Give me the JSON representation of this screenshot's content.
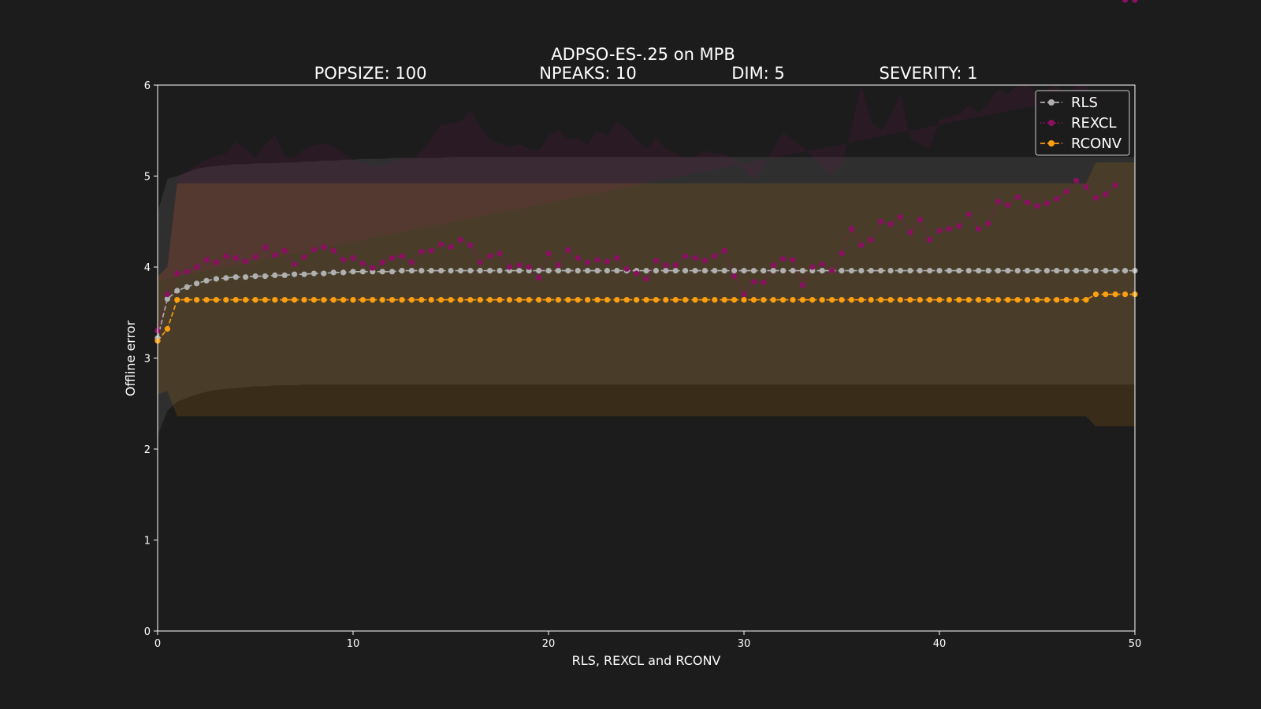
{
  "chart_data": {
    "type": "line",
    "title": "ADPSO-ES-.25 on MPB",
    "subtitles": [
      "POPSIZE: 100",
      "NPEAKS: 10",
      "DIM: 5",
      "SEVERITY: 1"
    ],
    "xlabel": "RLS, REXCL and RCONV",
    "ylabel": "Offline error",
    "xlim": [
      0,
      50
    ],
    "ylim": [
      0,
      6
    ],
    "xticks": [
      0,
      10,
      20,
      30,
      40,
      50
    ],
    "yticks": [
      0,
      1,
      2,
      3,
      4,
      5,
      6
    ],
    "grid": false,
    "legend_position": "top-right",
    "x": [
      0.0,
      0.5,
      1.0,
      1.5,
      2.0,
      2.5,
      3.0,
      3.5,
      4.0,
      4.5,
      5.0,
      5.5,
      6.0,
      6.5,
      7.0,
      7.5,
      8.0,
      8.5,
      9.0,
      9.5,
      10.0,
      10.5,
      11.0,
      11.5,
      12.0,
      12.5,
      13.0,
      13.5,
      14.0,
      14.5,
      15.0,
      15.5,
      16.0,
      16.5,
      17.0,
      17.5,
      18.0,
      18.5,
      19.0,
      19.5,
      20.0,
      20.5,
      21.0,
      21.5,
      22.0,
      22.5,
      23.0,
      23.5,
      24.0,
      24.5,
      25.0,
      25.5,
      26.0,
      26.5,
      27.0,
      27.5,
      28.0,
      28.5,
      29.0,
      29.5,
      30.0,
      30.5,
      31.0,
      31.5,
      32.0,
      32.5,
      33.0,
      33.5,
      34.0,
      34.5,
      35.0,
      35.5,
      36.0,
      36.5,
      37.0,
      37.5,
      38.0,
      38.5,
      39.0,
      39.5,
      40.0,
      40.5,
      41.0,
      41.5,
      42.0,
      42.5,
      43.0,
      43.5,
      44.0,
      44.5,
      45.0,
      45.5,
      46.0,
      46.5,
      47.0,
      47.5,
      48.0,
      48.5,
      49.0,
      49.5,
      50.0
    ],
    "series": [
      {
        "name": "RLS",
        "color": "#b0b0b0",
        "line": "dash",
        "values": [
          3.22,
          3.65,
          3.74,
          3.78,
          3.82,
          3.85,
          3.87,
          3.88,
          3.89,
          3.89,
          3.9,
          3.9,
          3.91,
          3.91,
          3.92,
          3.92,
          3.93,
          3.93,
          3.94,
          3.94,
          3.95,
          3.95,
          3.95,
          3.95,
          3.95,
          3.96,
          3.96,
          3.96,
          3.96,
          3.96,
          3.96,
          3.96,
          3.96,
          3.96,
          3.96,
          3.96,
          3.96,
          3.96,
          3.96,
          3.96,
          3.96,
          3.96,
          3.96,
          3.96,
          3.96,
          3.96,
          3.96,
          3.96,
          3.96,
          3.96,
          3.96,
          3.96,
          3.96,
          3.96,
          3.96,
          3.96,
          3.96,
          3.96,
          3.96,
          3.96,
          3.96,
          3.96,
          3.96,
          3.96,
          3.96,
          3.96,
          3.96,
          3.96,
          3.96,
          3.96,
          3.96,
          3.96,
          3.96,
          3.96,
          3.96,
          3.96,
          3.96,
          3.96,
          3.96,
          3.96,
          3.96,
          3.96,
          3.96,
          3.96,
          3.96,
          3.96,
          3.96,
          3.96,
          3.96,
          3.96,
          3.96,
          3.96,
          3.96,
          3.96,
          3.96,
          3.96,
          3.96,
          3.96,
          3.96,
          3.96,
          3.96
        ],
        "band_upper": [
          4.6,
          4.97,
          5.0,
          5.04,
          5.08,
          5.1,
          5.11,
          5.12,
          5.13,
          5.13,
          5.14,
          5.14,
          5.14,
          5.15,
          5.15,
          5.16,
          5.16,
          5.17,
          5.17,
          5.18,
          5.18,
          5.19,
          5.19,
          5.19,
          5.2,
          5.2,
          5.2,
          5.2,
          5.2,
          5.2,
          5.21,
          5.21,
          5.21,
          5.21,
          5.21,
          5.21,
          5.21,
          5.21,
          5.21,
          5.21,
          5.21,
          5.21,
          5.21,
          5.21,
          5.21,
          5.21,
          5.21,
          5.21,
          5.21,
          5.21,
          5.21,
          5.21,
          5.21,
          5.21,
          5.21,
          5.21,
          5.21,
          5.21,
          5.21,
          5.21,
          5.21,
          5.21,
          5.21,
          5.21,
          5.21,
          5.21,
          5.21,
          5.21,
          5.21,
          5.21,
          5.21,
          5.21,
          5.21,
          5.21,
          5.21,
          5.21,
          5.21,
          5.21,
          5.21,
          5.21,
          5.21,
          5.21,
          5.21,
          5.21,
          5.21,
          5.21,
          5.21,
          5.21,
          5.21,
          5.21,
          5.21,
          5.21,
          5.21,
          5.21,
          5.21,
          5.21,
          5.21,
          5.21,
          5.21,
          5.21,
          5.21
        ],
        "band_lower": [
          2.15,
          2.42,
          2.52,
          2.56,
          2.6,
          2.63,
          2.65,
          2.66,
          2.67,
          2.68,
          2.69,
          2.69,
          2.7,
          2.7,
          2.7,
          2.71,
          2.71,
          2.71,
          2.71,
          2.71,
          2.71,
          2.71,
          2.71,
          2.71,
          2.71,
          2.71,
          2.71,
          2.71,
          2.71,
          2.71,
          2.71,
          2.71,
          2.71,
          2.71,
          2.71,
          2.71,
          2.71,
          2.71,
          2.71,
          2.71,
          2.71,
          2.71,
          2.71,
          2.71,
          2.71,
          2.71,
          2.71,
          2.71,
          2.71,
          2.71,
          2.71,
          2.71,
          2.71,
          2.71,
          2.71,
          2.71,
          2.71,
          2.71,
          2.71,
          2.71,
          2.71,
          2.71,
          2.71,
          2.71,
          2.71,
          2.71,
          2.71,
          2.71,
          2.71,
          2.71,
          2.71,
          2.71,
          2.71,
          2.71,
          2.71,
          2.71,
          2.71,
          2.71,
          2.71,
          2.71,
          2.71,
          2.71,
          2.71,
          2.71,
          2.71,
          2.71,
          2.71,
          2.71,
          2.71,
          2.71,
          2.71,
          2.71,
          2.71,
          2.71,
          2.71,
          2.71,
          2.71,
          2.71,
          2.71,
          2.71,
          2.71
        ]
      },
      {
        "name": "REXCL",
        "color": "#8a1060",
        "line": "dotted",
        "values": [
          3.3,
          3.7,
          3.93,
          3.95,
          4.0,
          4.08,
          4.05,
          4.12,
          4.1,
          4.06,
          4.11,
          4.22,
          4.13,
          4.18,
          4.03,
          4.11,
          4.19,
          4.22,
          4.18,
          4.08,
          4.1,
          4.04,
          3.99,
          4.05,
          4.1,
          4.12,
          4.05,
          4.17,
          4.18,
          4.25,
          4.22,
          4.3,
          4.24,
          4.05,
          4.12,
          4.15,
          4.0,
          4.02,
          4.0,
          3.88,
          4.15,
          4.02,
          4.19,
          4.1,
          4.05,
          4.08,
          4.06,
          4.1,
          3.98,
          3.93,
          3.87,
          4.07,
          4.02,
          4.02,
          4.12,
          4.1,
          4.07,
          4.12,
          4.18,
          3.9,
          3.7,
          3.84,
          3.83,
          4.02,
          4.09,
          4.08,
          3.8,
          4.0,
          4.03,
          3.96,
          4.15,
          4.42,
          4.24,
          4.3,
          4.5,
          4.47,
          4.55,
          4.38,
          4.52,
          4.3,
          4.4,
          4.42,
          4.45,
          4.58,
          4.42,
          4.48,
          4.72,
          4.68,
          4.77,
          4.71,
          4.67,
          4.7,
          4.75,
          4.83,
          4.95,
          4.88,
          4.76,
          4.8,
          4.9
        ],
        "band_upper": [
          3.85,
          4.02,
          4.98,
          5.05,
          5.12,
          5.18,
          5.22,
          5.25,
          5.38,
          5.3,
          5.2,
          5.35,
          5.45,
          5.22,
          5.2,
          5.3,
          5.34,
          5.36,
          5.32,
          5.25,
          5.18,
          5.15,
          5.1,
          5.12,
          5.16,
          5.2,
          5.18,
          5.28,
          5.4,
          5.56,
          5.58,
          5.6,
          5.72,
          5.55,
          5.4,
          5.36,
          5.32,
          5.35,
          5.3,
          5.28,
          5.45,
          5.5,
          5.4,
          5.42,
          5.35,
          5.5,
          5.44,
          5.6,
          5.52,
          5.4,
          5.3,
          5.42,
          5.3,
          5.25,
          5.2,
          5.22,
          5.28,
          5.25,
          5.24,
          5.18,
          5.08,
          4.95,
          5.1,
          5.3,
          5.48,
          5.4,
          5.32,
          5.22,
          5.1,
          5.02,
          5.12,
          5.52,
          6.0,
          5.6,
          5.5,
          5.65,
          5.9,
          5.42,
          5.35,
          5.3,
          5.62,
          5.65,
          5.68,
          5.78,
          5.7,
          5.8,
          5.95,
          5.9,
          6.0,
          6.0,
          5.9,
          5.95,
          6.0,
          5.85,
          6.0,
          6.0,
          5.75,
          5.8,
          5.95
        ],
        "band_lower": [
          2.72,
          3.3,
          2.86,
          2.84,
          2.8,
          2.85,
          2.92,
          2.98,
          2.85,
          2.8,
          2.88,
          2.96,
          2.9,
          2.92,
          2.86,
          2.88,
          2.95,
          3.02,
          2.98,
          2.9,
          2.86,
          2.84,
          2.8,
          2.86,
          2.92,
          2.95,
          2.88,
          2.96,
          2.92,
          2.94,
          2.82,
          2.88,
          2.8,
          2.7,
          2.78,
          2.82,
          2.8,
          2.76,
          2.72,
          2.7,
          2.8,
          2.76,
          2.85,
          2.78,
          2.72,
          2.68,
          2.62,
          2.55,
          2.5,
          2.48,
          2.46,
          2.62,
          2.7,
          2.75,
          2.82,
          2.9,
          2.85,
          2.86,
          2.9,
          2.8,
          2.76,
          2.78,
          2.82,
          2.84,
          2.9,
          2.95,
          2.92,
          2.88,
          2.9,
          2.86,
          2.85,
          2.8,
          2.92,
          2.96,
          3.0,
          3.05,
          3.1,
          3.02,
          3.08,
          2.98,
          3.02,
          3.05,
          3.1,
          3.15,
          3.08,
          3.12,
          3.2,
          3.18,
          3.24,
          3.22,
          3.18,
          3.2,
          3.26,
          3.3,
          3.35,
          3.32,
          3.22,
          3.25,
          3.3
        ]
      },
      {
        "name": "RCONV",
        "color": "#ff9f0f",
        "line": "dash",
        "values": [
          3.19,
          3.32,
          3.64,
          3.64,
          3.64,
          3.64,
          3.64,
          3.64,
          3.64,
          3.64,
          3.64,
          3.64,
          3.64,
          3.64,
          3.64,
          3.64,
          3.64,
          3.64,
          3.64,
          3.64,
          3.64,
          3.64,
          3.64,
          3.64,
          3.64,
          3.64,
          3.64,
          3.64,
          3.64,
          3.64,
          3.64,
          3.64,
          3.64,
          3.64,
          3.64,
          3.64,
          3.64,
          3.64,
          3.64,
          3.64,
          3.64,
          3.64,
          3.64,
          3.64,
          3.64,
          3.64,
          3.64,
          3.64,
          3.64,
          3.64,
          3.64,
          3.64,
          3.64,
          3.64,
          3.64,
          3.64,
          3.64,
          3.64,
          3.64,
          3.64,
          3.64,
          3.64,
          3.64,
          3.64,
          3.64,
          3.64,
          3.64,
          3.64,
          3.64,
          3.64,
          3.64,
          3.64,
          3.64,
          3.64,
          3.64,
          3.64,
          3.64,
          3.64,
          3.64,
          3.64,
          3.64,
          3.64,
          3.64,
          3.64,
          3.64,
          3.64,
          3.64,
          3.64,
          3.64,
          3.64,
          3.64,
          3.64,
          3.64,
          3.64,
          3.64,
          3.64,
          3.7,
          3.7,
          3.7,
          3.7,
          3.7
        ],
        "band_upper": [
          3.9,
          4.0,
          4.92,
          4.92,
          4.92,
          4.92,
          4.92,
          4.92,
          4.92,
          4.92,
          4.92,
          4.92,
          4.92,
          4.92,
          4.92,
          4.92,
          4.92,
          4.92,
          4.92,
          4.92,
          4.92,
          4.92,
          4.92,
          4.92,
          4.92,
          4.92,
          4.92,
          4.92,
          4.92,
          4.92,
          4.92,
          4.92,
          4.92,
          4.92,
          4.92,
          4.92,
          4.92,
          4.92,
          4.92,
          4.92,
          4.92,
          4.92,
          4.92,
          4.92,
          4.92,
          4.92,
          4.92,
          4.92,
          4.92,
          4.92,
          4.92,
          4.92,
          4.92,
          4.92,
          4.92,
          4.92,
          4.92,
          4.92,
          4.92,
          4.92,
          4.92,
          4.92,
          4.92,
          4.92,
          4.92,
          4.92,
          4.92,
          4.92,
          4.92,
          4.92,
          4.92,
          4.92,
          4.92,
          4.92,
          4.92,
          4.92,
          4.92,
          4.92,
          4.92,
          4.92,
          4.92,
          4.92,
          4.92,
          4.92,
          4.92,
          4.92,
          4.92,
          4.92,
          4.92,
          4.92,
          4.92,
          4.92,
          4.92,
          4.92,
          4.92,
          4.92,
          5.15,
          5.15,
          5.15,
          5.15,
          5.15
        ],
        "band_lower": [
          2.6,
          2.64,
          2.36,
          2.36,
          2.36,
          2.36,
          2.36,
          2.36,
          2.36,
          2.36,
          2.36,
          2.36,
          2.36,
          2.36,
          2.36,
          2.36,
          2.36,
          2.36,
          2.36,
          2.36,
          2.36,
          2.36,
          2.36,
          2.36,
          2.36,
          2.36,
          2.36,
          2.36,
          2.36,
          2.36,
          2.36,
          2.36,
          2.36,
          2.36,
          2.36,
          2.36,
          2.36,
          2.36,
          2.36,
          2.36,
          2.36,
          2.36,
          2.36,
          2.36,
          2.36,
          2.36,
          2.36,
          2.36,
          2.36,
          2.36,
          2.36,
          2.36,
          2.36,
          2.36,
          2.36,
          2.36,
          2.36,
          2.36,
          2.36,
          2.36,
          2.36,
          2.36,
          2.36,
          2.36,
          2.36,
          2.36,
          2.36,
          2.36,
          2.36,
          2.36,
          2.36,
          2.36,
          2.36,
          2.36,
          2.36,
          2.36,
          2.36,
          2.36,
          2.36,
          2.36,
          2.36,
          2.36,
          2.36,
          2.36,
          2.36,
          2.36,
          2.36,
          2.36,
          2.36,
          2.36,
          2.36,
          2.36,
          2.36,
          2.36,
          2.36,
          2.36,
          2.25,
          2.25,
          2.25,
          2.25,
          2.25
        ]
      }
    ]
  }
}
